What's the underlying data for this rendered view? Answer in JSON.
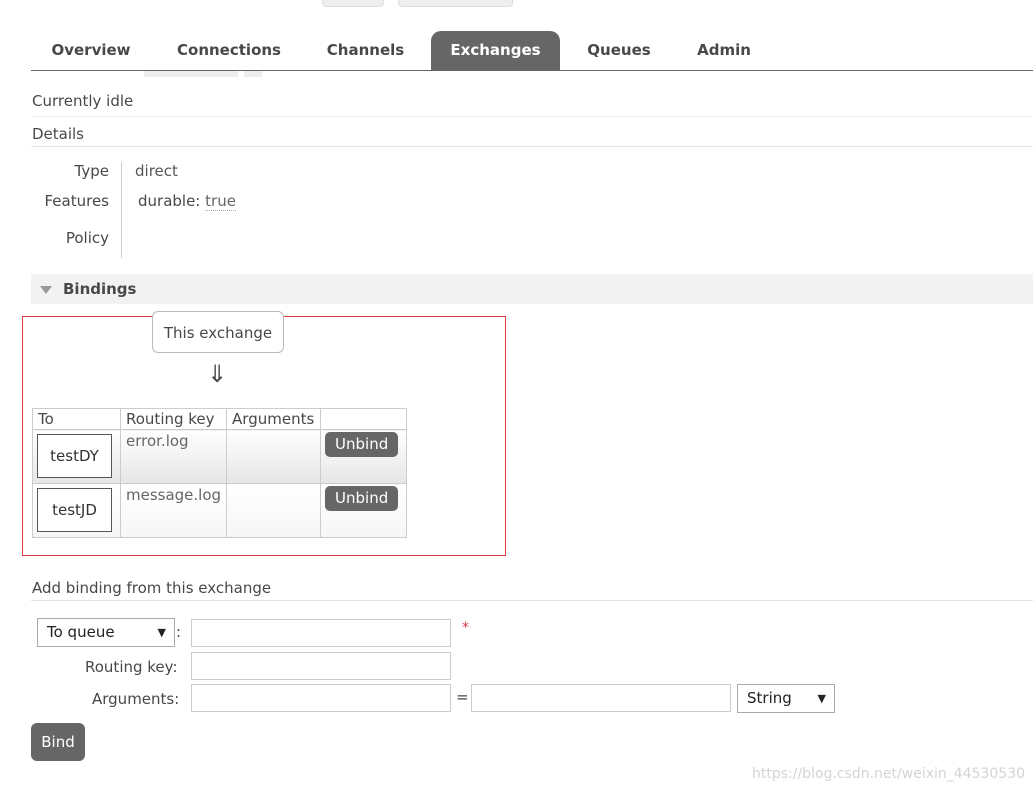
{
  "tabs": [
    {
      "label": "Overview",
      "active": false
    },
    {
      "label": "Connections",
      "active": false
    },
    {
      "label": "Channels",
      "active": false
    },
    {
      "label": "Exchanges",
      "active": true
    },
    {
      "label": "Queues",
      "active": false
    },
    {
      "label": "Admin",
      "active": false
    }
  ],
  "status_text": "Currently idle",
  "details": {
    "heading": "Details",
    "type_label": "Type",
    "type_value": "direct",
    "features_label": "Features",
    "features_key": "durable:",
    "features_value": "true",
    "policy_label": "Policy"
  },
  "bindings": {
    "heading": "Bindings",
    "this_exchange": "This exchange",
    "arrow": "⇓",
    "columns": [
      "To",
      "Routing key",
      "Arguments",
      ""
    ],
    "rows": [
      {
        "to": "testDY",
        "routing_key": "error.log",
        "arguments": "",
        "action": "Unbind"
      },
      {
        "to": "testJD",
        "routing_key": "message.log",
        "arguments": "",
        "action": "Unbind"
      }
    ]
  },
  "add_binding": {
    "heading": "Add binding from this exchange",
    "destination_select": "To queue",
    "colon": ":",
    "required_mark": "*",
    "routing_key_label": "Routing key:",
    "arguments_label": "Arguments:",
    "equals": "=",
    "type_select": "String",
    "bind_button": "Bind"
  },
  "watermark": "https://blog.csdn.net/weixin_44530530",
  "colors": {
    "tab_active_bg": "#666666",
    "button_bg": "#666666",
    "highlight_border": "#e0383e",
    "required_mark": "#e0383e"
  }
}
